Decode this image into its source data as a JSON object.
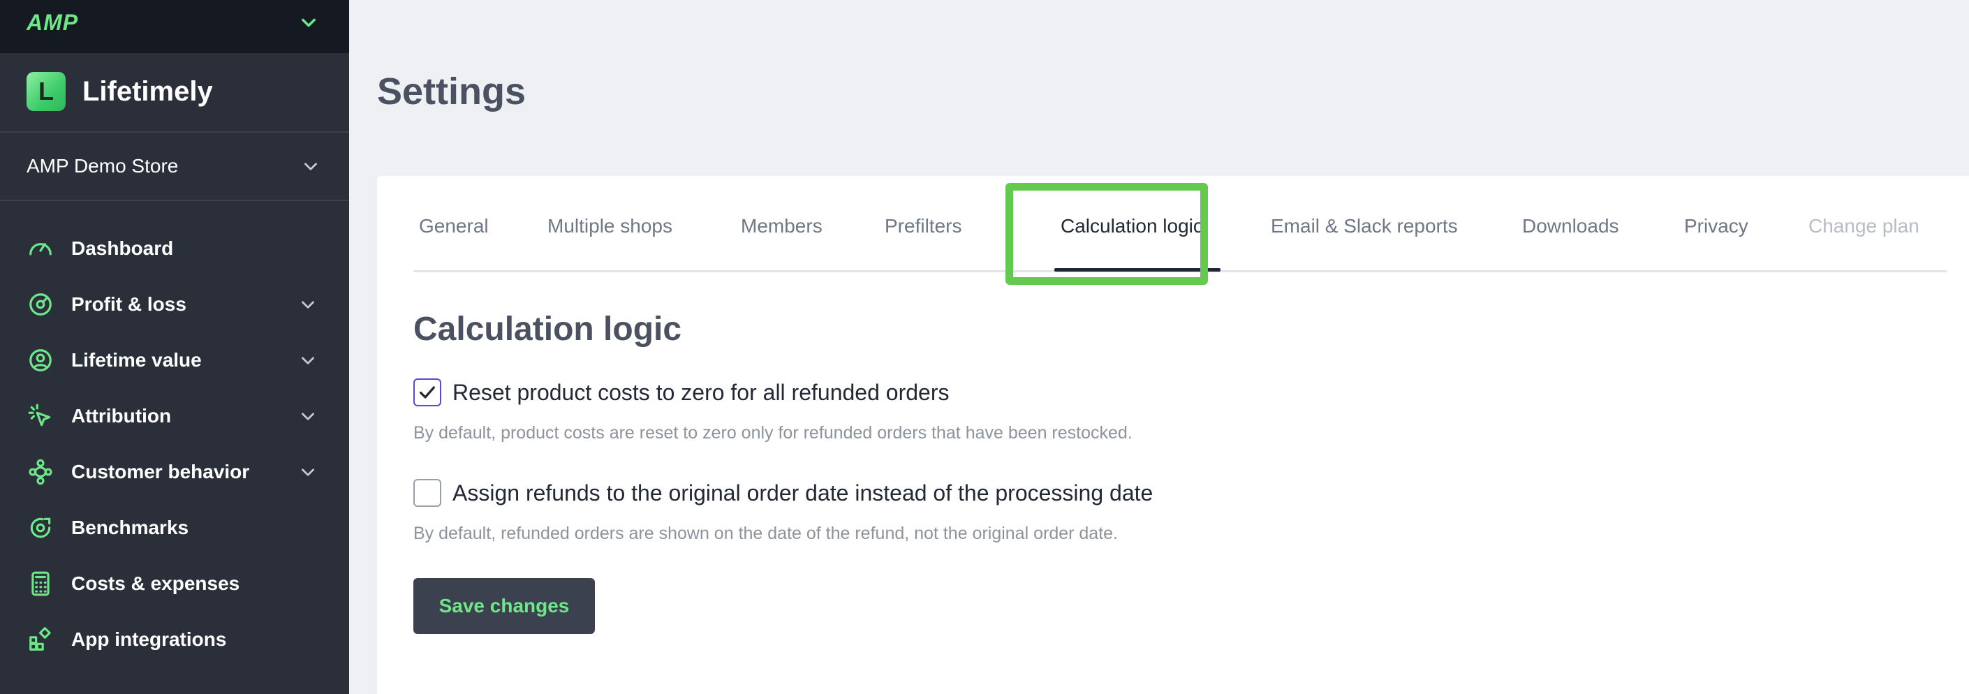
{
  "topbar": {
    "logo": "AMP"
  },
  "brand": {
    "mark": "L",
    "name": "Lifetimely"
  },
  "store": {
    "name": "AMP Demo Store"
  },
  "nav": {
    "items": [
      {
        "label": "Dashboard",
        "icon": "gauge-icon"
      },
      {
        "label": "Profit & loss",
        "icon": "dial-icon"
      },
      {
        "label": "Lifetime value",
        "icon": "user-circle-icon"
      },
      {
        "label": "Attribution",
        "icon": "cursor-click-icon"
      },
      {
        "label": "Customer behavior",
        "icon": "flow-icon"
      },
      {
        "label": "Benchmarks",
        "icon": "target-icon"
      },
      {
        "label": "Costs & expenses",
        "icon": "calculator-icon"
      },
      {
        "label": "App integrations",
        "icon": "apps-icon"
      }
    ]
  },
  "page": {
    "title": "Settings"
  },
  "tabs": [
    {
      "label": "General"
    },
    {
      "label": "Multiple shops"
    },
    {
      "label": "Members"
    },
    {
      "label": "Prefilters"
    },
    {
      "label": "Calculation logic"
    },
    {
      "label": "Email & Slack reports"
    },
    {
      "label": "Downloads"
    },
    {
      "label": "Privacy"
    },
    {
      "label": "Change plan"
    }
  ],
  "calc": {
    "title": "Calculation logic",
    "option1": {
      "label": "Reset product costs to zero for all refunded orders",
      "checked": true,
      "help": "By default, product costs are reset to zero only for refunded orders that have been restocked."
    },
    "option2": {
      "label": "Assign refunds to the original order date instead of the processing date",
      "checked": false,
      "help": "By default, refunded orders are shown on the date of the refund, not the original order date."
    },
    "save_label": "Save changes"
  },
  "colors": {
    "accent": "#6ee788",
    "highlight": "#64ca4f",
    "checkbox": "#5d47d6",
    "sidebar": "#2a2f39"
  }
}
